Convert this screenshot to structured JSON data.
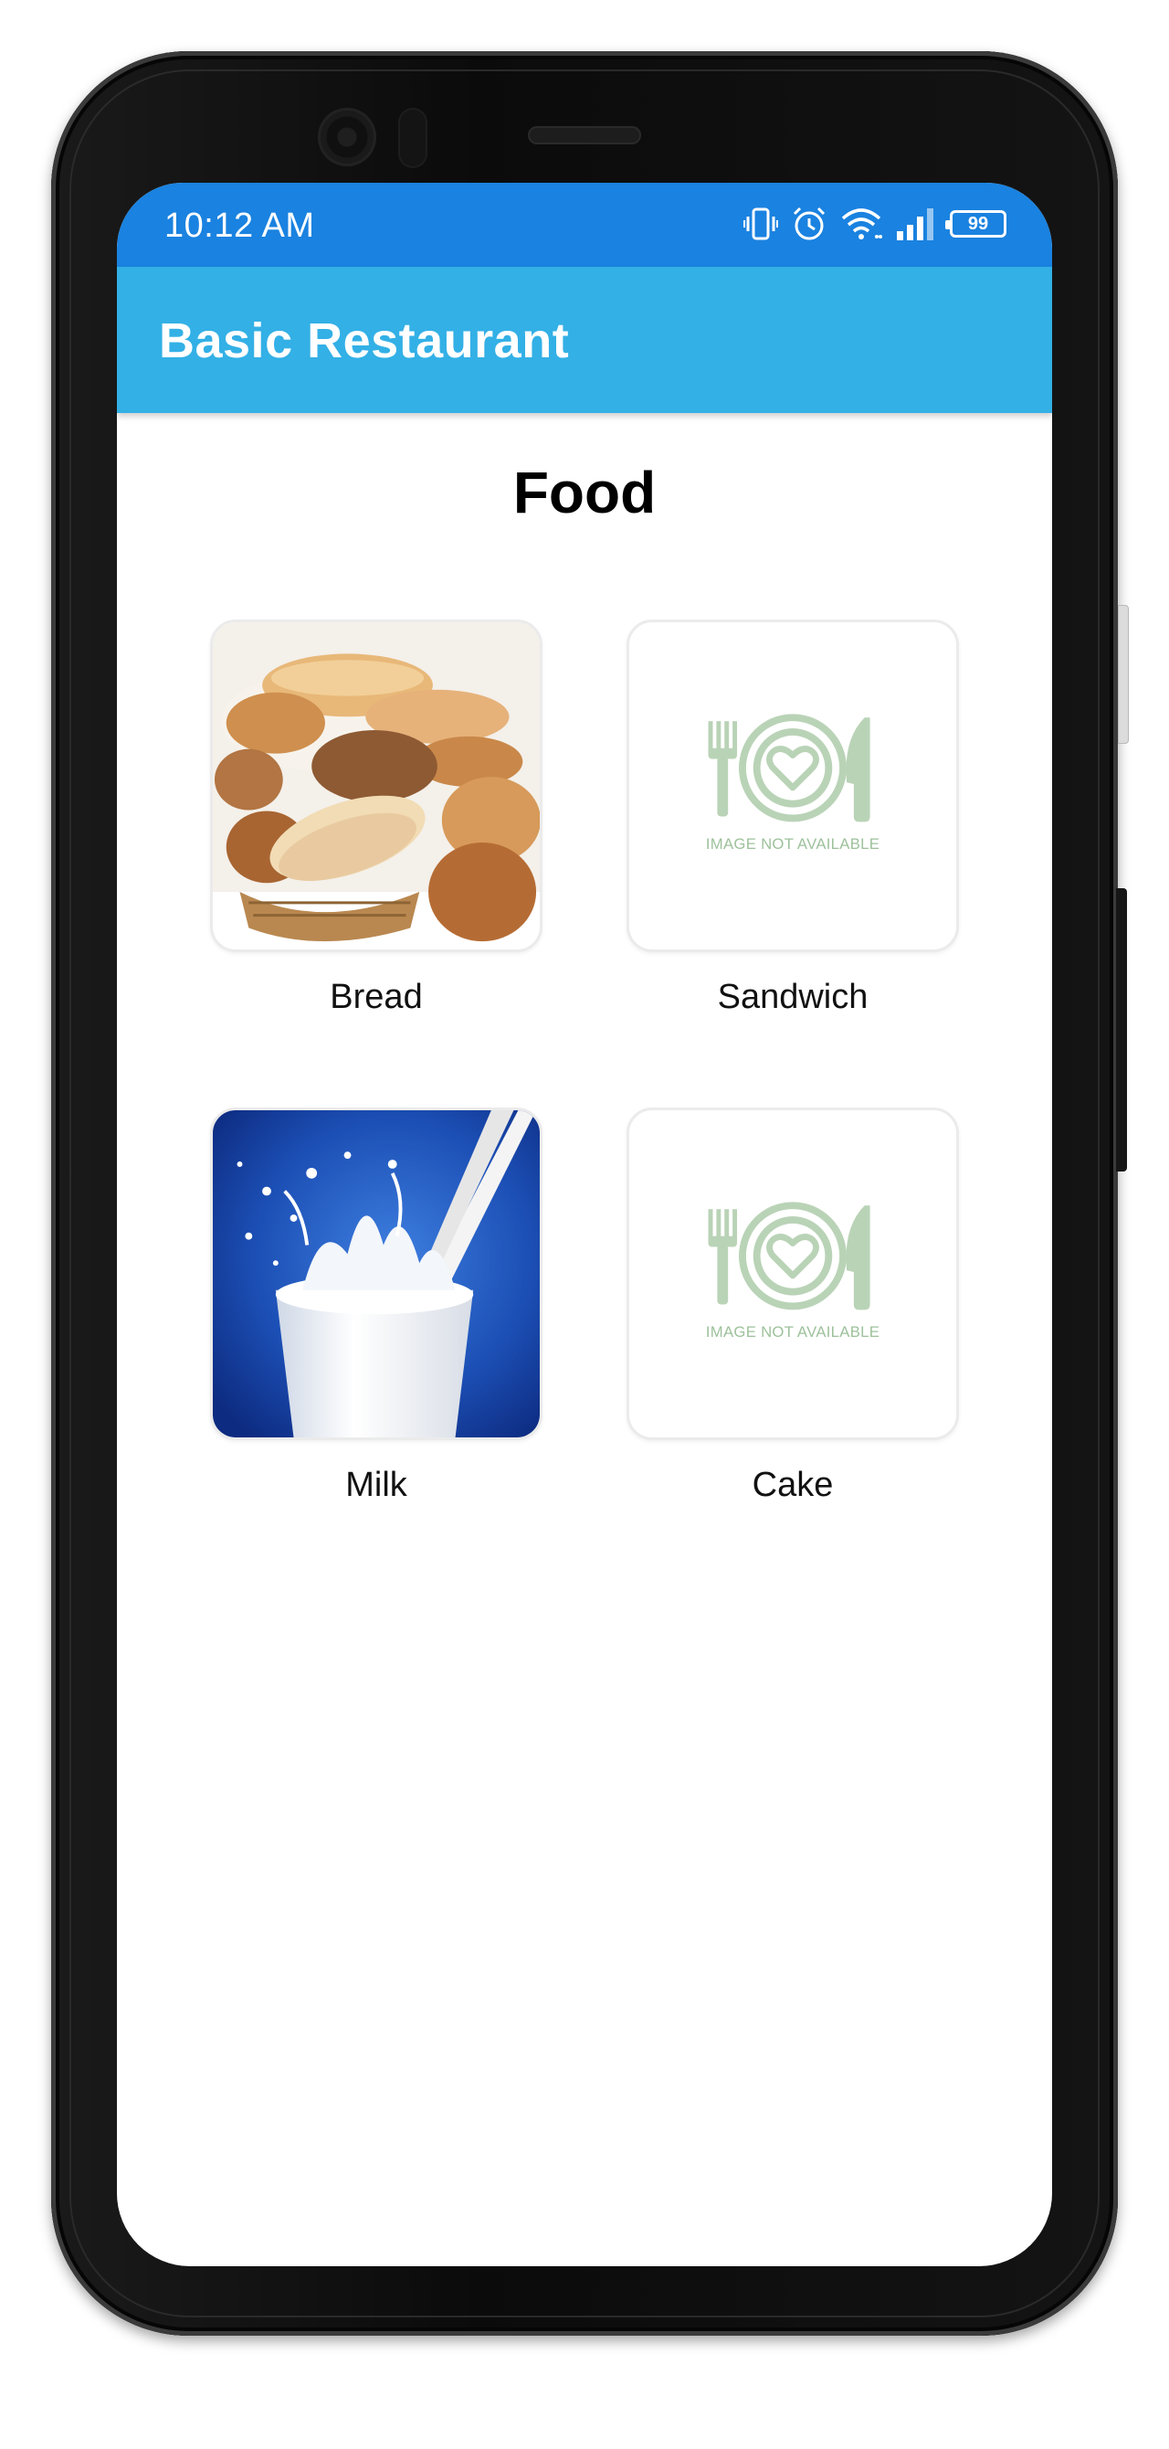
{
  "status_bar": {
    "time": "10:12 AM",
    "battery_level": "99",
    "icons": [
      "vibrate-icon",
      "alarm-icon",
      "wifi-icon",
      "signal-icon",
      "battery-icon"
    ]
  },
  "app_bar": {
    "title": "Basic Restaurant"
  },
  "page": {
    "heading": "Food"
  },
  "food_items": [
    {
      "label": "Bread",
      "image": "bread-basket-photo"
    },
    {
      "label": "Sandwich",
      "image": "image-not-available-placeholder"
    },
    {
      "label": "Milk",
      "image": "milk-glass-photo"
    },
    {
      "label": "Cake",
      "image": "image-not-available-placeholder"
    }
  ],
  "placeholder": {
    "text": "IMAGE NOT AVAILABLE"
  },
  "colors": {
    "status_bar": "#1a82e0",
    "app_bar": "#33b0e6",
    "placeholder_green": "#9dc19b"
  }
}
